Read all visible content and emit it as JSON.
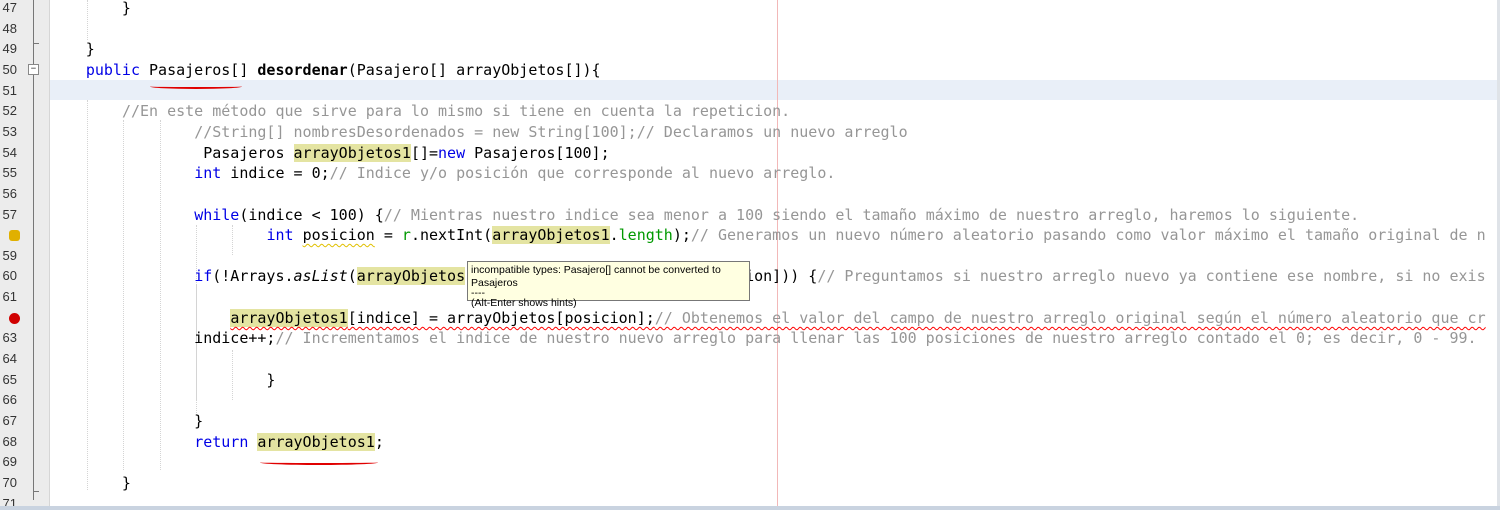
{
  "editor": {
    "line_numbers": [
      "47",
      "48",
      "49",
      "50",
      "51",
      "52",
      "53",
      "54",
      "55",
      "56",
      "57",
      "",
      "59",
      "60",
      "61",
      "",
      "63",
      "64",
      "65",
      "66",
      "67",
      "68",
      "69",
      "70",
      "71"
    ],
    "gutter_icons": [
      {
        "line": 58,
        "icon": "hint-bulb-icon",
        "color": "#e0b000"
      },
      {
        "line": 62,
        "icon": "error-icon",
        "color": "#d00000"
      }
    ],
    "lines": [
      {
        "n": 47,
        "seg": [
          {
            "t": "        }"
          }
        ]
      },
      {
        "n": 48,
        "seg": []
      },
      {
        "n": 49,
        "seg": [
          {
            "t": "    }"
          }
        ]
      },
      {
        "n": 50,
        "seg": [
          {
            "t": "    "
          },
          {
            "t": "public",
            "c": "kw"
          },
          {
            "t": " Pasajeros[] "
          },
          {
            "t": "desordenar",
            "c": "bd"
          },
          {
            "t": "(Pasajero[] arrayObjetos[]){"
          }
        ]
      },
      {
        "n": 51,
        "seg": []
      },
      {
        "n": 52,
        "seg": [
          {
            "t": "        "
          },
          {
            "t": "//En este método que sirve para lo mismo si tiene en cuenta la repeticion.",
            "c": "cm"
          }
        ]
      },
      {
        "n": 53,
        "seg": [
          {
            "t": "                "
          },
          {
            "t": "//String[] nombresDesordenados = new String[100];// Declaramos un nuevo arreglo",
            "c": "cm"
          }
        ]
      },
      {
        "n": 54,
        "seg": [
          {
            "t": "                 Pasajeros "
          },
          {
            "t": "arrayObjetos1",
            "c": "hl"
          },
          {
            "t": "[]="
          },
          {
            "t": "new",
            "c": "kw"
          },
          {
            "t": " Pasajeros[100];"
          }
        ]
      },
      {
        "n": 55,
        "seg": [
          {
            "t": "                "
          },
          {
            "t": "int",
            "c": "kw"
          },
          {
            "t": " indice = 0;"
          },
          {
            "t": "// Indice y/o posición que corresponde al nuevo arreglo.",
            "c": "cm"
          }
        ]
      },
      {
        "n": 56,
        "seg": []
      },
      {
        "n": 57,
        "seg": [
          {
            "t": "                "
          },
          {
            "t": "while",
            "c": "kw"
          },
          {
            "t": "(indice < 100) {"
          },
          {
            "t": "// Mientras nuestro indice sea menor a 100 siendo el tamaño máximo de nuestro arreglo, haremos lo siguiente.",
            "c": "cm"
          }
        ]
      },
      {
        "n": 58,
        "seg": [
          {
            "t": "                        "
          },
          {
            "t": "int",
            "c": "kw"
          },
          {
            "t": " "
          },
          {
            "t": "posicion",
            "c": "warn"
          },
          {
            "t": " = "
          },
          {
            "t": "r",
            "c": "fld"
          },
          {
            "t": ".nextInt("
          },
          {
            "t": "arrayObjetos1",
            "c": "hl"
          },
          {
            "t": "."
          },
          {
            "t": "length",
            "c": "fld"
          },
          {
            "t": ");"
          },
          {
            "t": "// Generamos un nuevo número aleatorio pasando como valor máximo el tamaño original de n",
            "c": "cm"
          }
        ]
      },
      {
        "n": 59,
        "seg": []
      },
      {
        "n": 60,
        "seg": [
          {
            "t": "                "
          },
          {
            "t": "if",
            "c": "kw"
          },
          {
            "t": "(!Arrays."
          },
          {
            "t": "asList",
            "c": "it"
          },
          {
            "t": "("
          },
          {
            "t": "arrayObjetos",
            "c": "hl"
          },
          {
            "t": "                               "
          },
          {
            "t": "ion])) {"
          },
          {
            "t": "// Preguntamos si nuestro arreglo nuevo ya contiene ese nombre, si no exis",
            "c": "cm"
          }
        ]
      },
      {
        "n": 61,
        "seg": []
      },
      {
        "n": 62,
        "seg": [
          {
            "t": "                    "
          },
          {
            "t": "arrayObjetos1",
            "c": "hl err"
          },
          {
            "t": "[indice] = arrayObjetos[posicion];",
            "c": "err"
          },
          {
            "t": "// Obtenemos el valor del campo de nuestro arreglo original según el número aleatorio que cr",
            "c": "cm err"
          }
        ]
      },
      {
        "n": 63,
        "seg": [
          {
            "t": "                indice++;"
          },
          {
            "t": "// Incrementamos el indice de nuestro nuevo arreglo para llenar las 100 posiciones de nuestro arreglo contado el 0; es decir, 0 - 99.",
            "c": "cm"
          }
        ]
      },
      {
        "n": 64,
        "seg": []
      },
      {
        "n": 65,
        "seg": [
          {
            "t": "                        }"
          }
        ]
      },
      {
        "n": 66,
        "seg": []
      },
      {
        "n": 67,
        "seg": [
          {
            "t": "                }"
          }
        ]
      },
      {
        "n": 68,
        "seg": [
          {
            "t": "                "
          },
          {
            "t": "return",
            "c": "kw"
          },
          {
            "t": " "
          },
          {
            "t": "arrayObjetos1",
            "c": "hl"
          },
          {
            "t": ";"
          }
        ]
      },
      {
        "n": 69,
        "seg": []
      },
      {
        "n": 70,
        "seg": [
          {
            "t": "        }"
          }
        ]
      },
      {
        "n": 71,
        "seg": []
      }
    ]
  },
  "tooltip": {
    "message": "incompatible types: Pasajero[] cannot be converted to Pasajeros",
    "separator": "----",
    "hint": "(Alt-Enter shows hints)"
  },
  "colors": {
    "keyword": "#0000e6",
    "comment": "#969696",
    "highlight": "#e4e4a2",
    "error": "#ff0000",
    "annotation": "#e00000"
  }
}
